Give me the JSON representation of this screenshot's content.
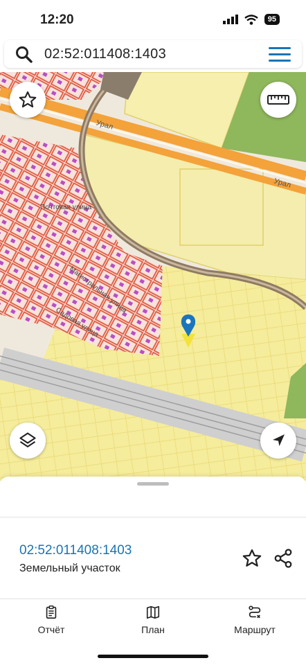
{
  "status": {
    "time": "12:20",
    "battery": "95"
  },
  "search": {
    "query": "02:52:011408:1403"
  },
  "map": {
    "street_labels": [
      "Почтовая улица",
      "Садовая улица",
      "Урал",
      "Урал"
    ],
    "street_diag": "Магистральная улица"
  },
  "card": {
    "cadastral_number": "02:52:011408:1403",
    "type": "Земельный участок"
  },
  "tabs": [
    {
      "label": "Отчёт",
      "icon": "clipboard-icon"
    },
    {
      "label": "План",
      "icon": "map-book-icon"
    },
    {
      "label": "Маршрут",
      "icon": "route-icon"
    }
  ],
  "colors": {
    "accent": "#1a73b5",
    "plots_red": "#e3604a",
    "plots_yellow": "#f2e88e"
  }
}
